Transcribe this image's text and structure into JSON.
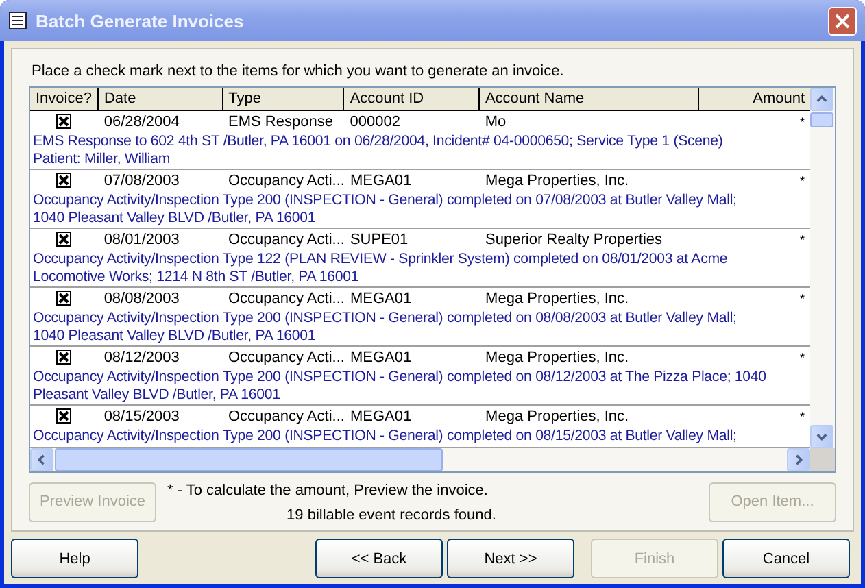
{
  "window": {
    "title": "Batch Generate Invoices"
  },
  "instruction": "Place a check mark next to the items for which you want to generate an invoice.",
  "table": {
    "columns": [
      "Invoice?",
      "Date",
      "Type",
      "Account ID",
      "Account Name",
      "Amount"
    ],
    "rows": [
      {
        "invoice": true,
        "date": "06/28/2004",
        "type": "EMS Response",
        "account_id": "000002",
        "account_name": "Mo",
        "amount": "*",
        "description": "EMS Response to 602 4th ST /Butler, PA 16001 on 06/28/2004, Incident# 04-0000650; Service Type 1 (Scene)\nPatient: Miller, William"
      },
      {
        "invoice": true,
        "date": "07/08/2003",
        "type": "Occupancy Acti...",
        "account_id": "MEGA01",
        "account_name": "Mega Properties, Inc.",
        "amount": "*",
        "description": "Occupancy Activity/Inspection Type 200 (INSPECTION - General) completed on 07/08/2003 at Butler Valley Mall;\n1040 Pleasant Valley BLVD /Butler, PA 16001"
      },
      {
        "invoice": true,
        "date": "08/01/2003",
        "type": "Occupancy Acti...",
        "account_id": "SUPE01",
        "account_name": "Superior Realty Properties",
        "amount": "*",
        "description": "Occupancy Activity/Inspection Type 122 (PLAN REVIEW - Sprinkler System) completed on 08/01/2003 at Acme\nLocomotive Works; 1214 N 8th ST /Butler, PA 16001"
      },
      {
        "invoice": true,
        "date": "08/08/2003",
        "type": "Occupancy Acti...",
        "account_id": "MEGA01",
        "account_name": "Mega Properties, Inc.",
        "amount": "*",
        "description": "Occupancy Activity/Inspection Type 200 (INSPECTION - General) completed on 08/08/2003 at Butler Valley Mall;\n1040 Pleasant Valley BLVD /Butler, PA 16001"
      },
      {
        "invoice": true,
        "date": "08/12/2003",
        "type": "Occupancy Acti...",
        "account_id": "MEGA01",
        "account_name": "Mega Properties, Inc.",
        "amount": "*",
        "description": "Occupancy Activity/Inspection Type 200 (INSPECTION - General) completed on 08/12/2003 at The Pizza Place; 1040\nPleasant Valley BLVD /Butler, PA 16001"
      },
      {
        "invoice": true,
        "date": "08/15/2003",
        "type": "Occupancy Acti...",
        "account_id": "MEGA01",
        "account_name": "Mega Properties, Inc.",
        "amount": "*",
        "description": "Occupancy Activity/Inspection Type 200 (INSPECTION - General) completed on 08/15/2003 at Butler Valley Mall;"
      }
    ]
  },
  "note": "* - To calculate the amount, Preview the invoice.",
  "status": "19 billable event records found.",
  "panel_buttons": [
    {
      "label": "Preview Invoice",
      "disabled": true
    },
    {
      "label": "Open Item...",
      "disabled": true
    }
  ],
  "buttons": [
    {
      "label": "Help",
      "disabled": false
    },
    {
      "label": "<< Back",
      "disabled": false
    },
    {
      "label": "Next >>",
      "disabled": false
    },
    {
      "label": "Finish",
      "disabled": true
    },
    {
      "label": "Cancel",
      "disabled": false
    }
  ]
}
